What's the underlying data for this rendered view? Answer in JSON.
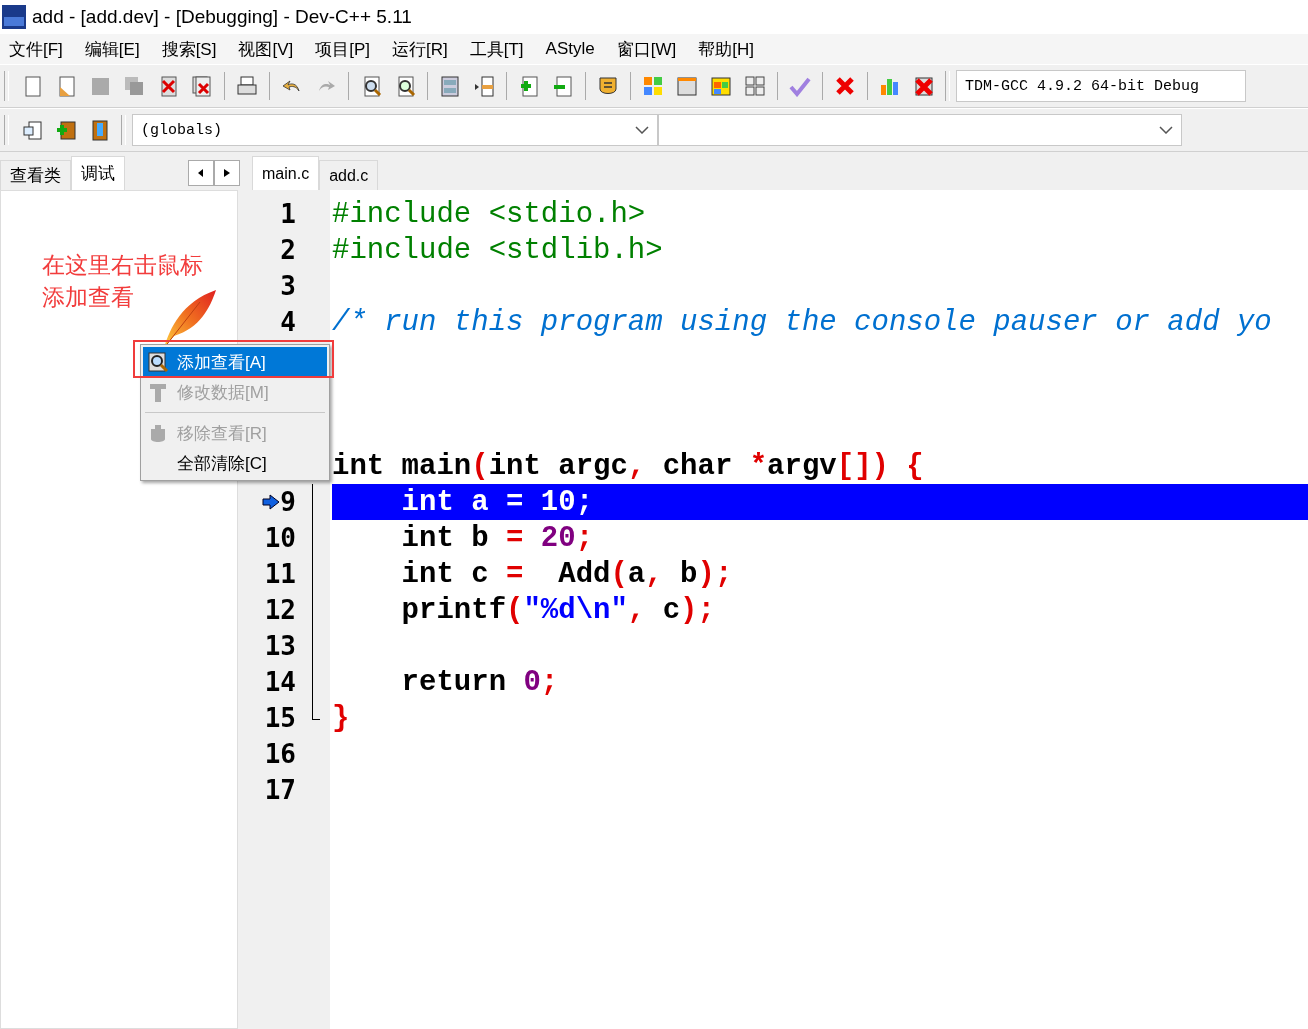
{
  "window": {
    "title": "add - [add.dev] - [Debugging] - Dev-C++ 5.11"
  },
  "menu": [
    "文件[F]",
    "编辑[E]",
    "搜索[S]",
    "视图[V]",
    "项目[P]",
    "运行[R]",
    "工具[T]",
    "AStyle",
    "窗口[W]",
    "帮助[H]"
  ],
  "compiler_select": {
    "value": "TDM-GCC 4.9.2 64-bit Debug"
  },
  "class_select": {
    "value": "(globals)"
  },
  "left_tabs": [
    {
      "label": "查看类",
      "selected": false
    },
    {
      "label": "调试",
      "selected": true
    }
  ],
  "editor_tabs": [
    {
      "label": "main.c",
      "selected": true
    },
    {
      "label": "add.c",
      "selected": false
    }
  ],
  "annotation": [
    "在这里右击鼠标",
    "添加查看"
  ],
  "context_menu": [
    {
      "kind": "item",
      "label": "添加查看[A]",
      "selected": true,
      "disabled": false
    },
    {
      "kind": "item",
      "label": "修改数据[M]",
      "selected": false,
      "disabled": true
    },
    {
      "kind": "separator"
    },
    {
      "kind": "item",
      "label": "移除查看[R]",
      "selected": false,
      "disabled": true
    },
    {
      "kind": "item",
      "label": "全部清除[C]",
      "selected": false,
      "disabled": false
    }
  ],
  "editor": {
    "lines": [
      {
        "number": "1",
        "current": false,
        "fold": false,
        "tokens": [
          {
            "kind": "preprocessor",
            "text": "#include <stdio.h>"
          }
        ]
      },
      {
        "number": "2",
        "current": false,
        "fold": false,
        "tokens": [
          {
            "kind": "preprocessor",
            "text": "#include <stdlib.h>"
          }
        ]
      },
      {
        "number": "3",
        "current": false,
        "fold": false
      },
      {
        "number": "4",
        "current": false,
        "fold": false,
        "tokens": [
          {
            "kind": "comment",
            "text": "/* run this program using the console pauser or add yo"
          }
        ]
      },
      {
        "current": false,
        "fold": false
      },
      {
        "current": false,
        "fold": false
      },
      {
        "current": false,
        "fold": false
      },
      {
        "current": false,
        "fold": false,
        "tokens": [
          {
            "kind": "text",
            "text": "int main"
          },
          {
            "kind": "symbol",
            "text": "("
          },
          {
            "kind": "text",
            "text": "int argc"
          },
          {
            "kind": "symbol",
            "text": ","
          },
          {
            "kind": "text",
            "text": " char "
          },
          {
            "kind": "symbol",
            "text": "*"
          },
          {
            "kind": "text",
            "text": "argv"
          },
          {
            "kind": "symbol",
            "text": "[]) {"
          }
        ]
      },
      {
        "number": "9",
        "current": true,
        "fold": true,
        "tokens": [
          {
            "kind": "text",
            "text": "    int a = 10;"
          }
        ]
      },
      {
        "number": "10",
        "current": false,
        "fold": true,
        "tokens": [
          {
            "kind": "text",
            "text": "    int b "
          },
          {
            "kind": "symbol",
            "text": "="
          },
          {
            "kind": "number",
            "text": " 20"
          },
          {
            "kind": "symbol",
            "text": ";"
          }
        ]
      },
      {
        "number": "11",
        "current": false,
        "fold": true,
        "tokens": [
          {
            "kind": "text",
            "text": "    int c "
          },
          {
            "kind": "symbol",
            "text": "="
          },
          {
            "kind": "text",
            "text": "  Add"
          },
          {
            "kind": "symbol",
            "text": "("
          },
          {
            "kind": "text",
            "text": "a"
          },
          {
            "kind": "symbol",
            "text": ","
          },
          {
            "kind": "text",
            "text": " b"
          },
          {
            "kind": "symbol",
            "text": ");"
          }
        ]
      },
      {
        "number": "12",
        "current": false,
        "fold": true,
        "tokens": [
          {
            "kind": "text",
            "text": "    printf"
          },
          {
            "kind": "symbol",
            "text": "("
          },
          {
            "kind": "string",
            "text": "\"%d\\n\""
          },
          {
            "kind": "symbol",
            "text": ","
          },
          {
            "kind": "text",
            "text": " c"
          },
          {
            "kind": "symbol",
            "text": ");"
          }
        ]
      },
      {
        "number": "13",
        "current": false,
        "fold": true
      },
      {
        "number": "14",
        "current": false,
        "fold": true,
        "tokens": [
          {
            "kind": "text",
            "text": "    return "
          },
          {
            "kind": "number",
            "text": "0"
          },
          {
            "kind": "symbol",
            "text": ";"
          }
        ]
      },
      {
        "number": "15",
        "current": false,
        "fold": true,
        "tokens": [
          {
            "kind": "symbol",
            "text": "}"
          }
        ]
      },
      {
        "number": "16",
        "current": false,
        "fold": false
      },
      {
        "number": "17",
        "current": false,
        "fold": false
      }
    ]
  }
}
